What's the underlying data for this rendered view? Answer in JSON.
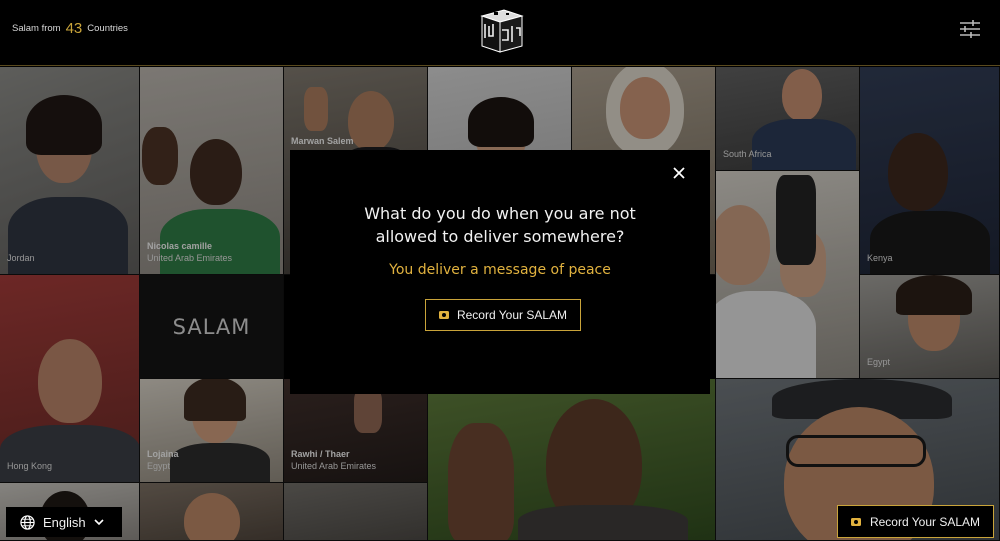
{
  "header": {
    "counter_prefix": "Salam from",
    "counter_number": "43",
    "counter_suffix": "Countries",
    "logo_icon": "cube-logo-icon",
    "settings_icon": "sliders-icon"
  },
  "tiles": [
    {
      "name": "",
      "country": "Jordan"
    },
    {
      "name": "Nicolas camille",
      "country": "United Arab Emirates"
    },
    {
      "name": "Marwan Salem",
      "country": ""
    },
    {
      "name": "",
      "country": "South Africa"
    },
    {
      "name": "",
      "country": "Kenya"
    },
    {
      "name": "",
      "country": "Egypt"
    },
    {
      "name": "",
      "country": "Hong Kong"
    },
    {
      "name": "Lojaina",
      "country": "Egypt"
    },
    {
      "name": "Rawhi / Thaer",
      "country": "United Arab Emirates"
    }
  ],
  "salam_tile": "SALAM",
  "modal": {
    "question_line1": "What do you do when you are not",
    "question_line2": "allowed to deliver somewhere?",
    "answer": "You deliver a message of peace",
    "record_label": "Record Your SALAM",
    "close_icon": "close-icon",
    "camera_icon": "camera-icon"
  },
  "language": {
    "selected": "English",
    "globe_icon": "globe-icon",
    "chevron_icon": "chevron-down-icon"
  },
  "bottom_record": {
    "label": "Record Your SALAM"
  },
  "colors": {
    "accent": "#c9a43a",
    "answer": "#e1b23f",
    "background": "#000000"
  }
}
